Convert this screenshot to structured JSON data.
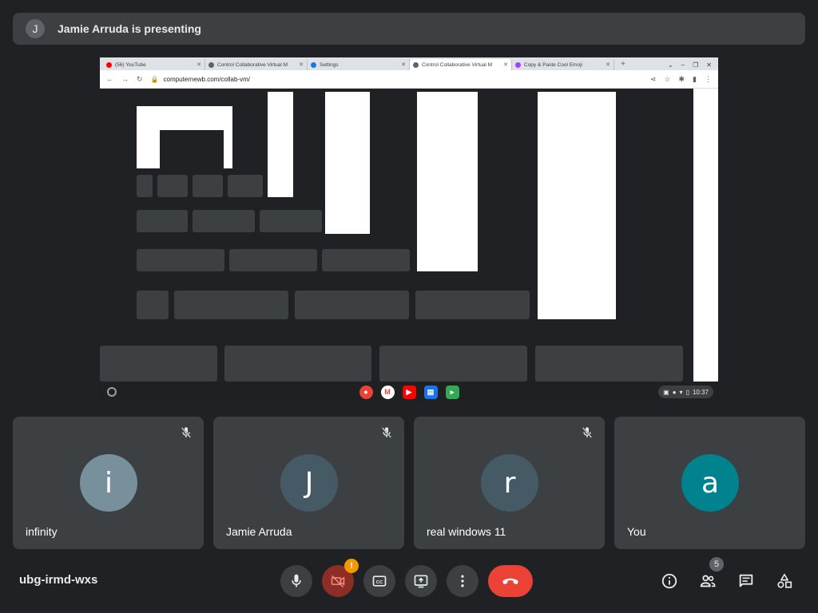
{
  "banner": {
    "avatar_letter": "J",
    "text": "Jamie Arruda is presenting"
  },
  "browser": {
    "tabs": [
      {
        "label": "(56) YouTube",
        "color": "#ff0000",
        "active": false
      },
      {
        "label": "Control Collaborative Virtual M",
        "color": "#5f6368",
        "active": false
      },
      {
        "label": "Settings",
        "color": "#1a73e8",
        "active": false
      },
      {
        "label": "Control Collaborative Virtual M",
        "color": "#5f6368",
        "active": true
      },
      {
        "label": "Copy & Paste Cool Emoji",
        "color": "#a142f4",
        "active": false
      }
    ],
    "url": "computernewb.com/collab-vm/",
    "clock": "10:37"
  },
  "participants": [
    {
      "letter": "i",
      "name": "infinity",
      "color": "#78909c",
      "muted": true
    },
    {
      "letter": "J",
      "name": "Jamie Arruda",
      "color": "#455a64",
      "muted": true
    },
    {
      "letter": "r",
      "name": "real windows 11",
      "color": "#455a64",
      "muted": true
    },
    {
      "letter": "a",
      "name": "You",
      "color": "#00838f",
      "muted": false
    }
  ],
  "meeting_code": "ubg-irmd-wxs",
  "participant_count": "5",
  "camera_warning": "!",
  "colors": {
    "background": "#202124",
    "tile": "#3c4043",
    "hangup": "#ea4335"
  },
  "icons": [
    "mic-icon",
    "camera-off-icon",
    "captions-icon",
    "present-icon",
    "more-vert-icon",
    "call-end-icon",
    "info-icon",
    "people-icon",
    "chat-icon",
    "activities-icon"
  ]
}
